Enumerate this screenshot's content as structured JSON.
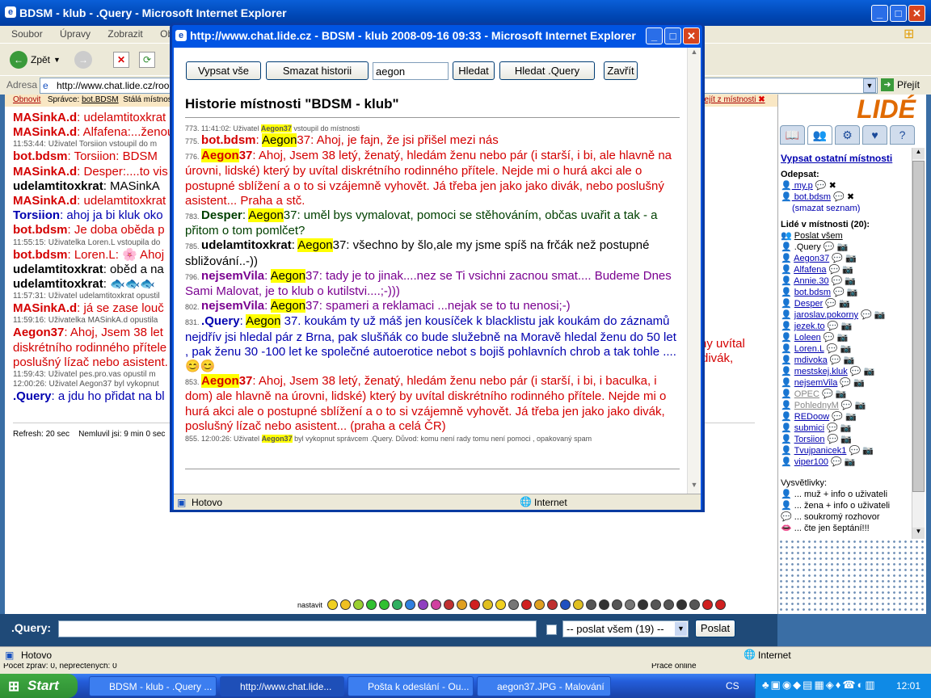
{
  "main_window": {
    "title": "BDSM - klub - .Query - Microsoft Internet Explorer",
    "menu": [
      "Soubor",
      "Úpravy",
      "Zobrazit",
      "Oblíbené"
    ],
    "toolbar": {
      "back": "Zpět"
    },
    "address_label": "Adresa",
    "address_value": "http://www.chat.lide.cz/room",
    "go_label": "Přejít"
  },
  "room_bar": {
    "refresh": "Obnovit",
    "admin_prefix": "Správce:",
    "admin": "bot.BDSM",
    "permanent": "Stálá místnost",
    "leave": "dejít z místnosti"
  },
  "chat_lines": [
    {
      "nick": "MASinkA.d",
      "text": ": udelamtitoxkrat",
      "cls": "red"
    },
    {
      "nick": "MASinkA.d",
      "text": ": Alfafena:...ženou",
      "cls": "red"
    },
    {
      "sys": "11:53:44: Uživatel Torsiion vstoupil do m"
    },
    {
      "nick": "bot.bdsm",
      "text": ": Torsiion: BDSM",
      "cls": "red"
    },
    {
      "nick": "MASinkA.d",
      "text": ": Desper:....to vis",
      "cls": "red"
    },
    {
      "nick": "udelamtitoxkrat",
      "text": ": MASinkA",
      "cls": "blk"
    },
    {
      "nick": "MASinkA.d",
      "text": ": udelamtitoxkrat",
      "cls": "red"
    },
    {
      "nick": "Torsiion",
      "text": ": ahoj ja bi kluk oko",
      "cls": "blu"
    },
    {
      "nick": "bot.bdsm",
      "text": ": Je doba oběda p",
      "cls": "red"
    },
    {
      "sys": "11:55:15: Uživatelka Loren.L vstoupila do"
    },
    {
      "nick": "bot.bdsm",
      "text": ": Loren.L: 🌸 Ahoj",
      "cls": "red"
    },
    {
      "nick": "udelamtitoxkrat",
      "text": ": oběd a na",
      "cls": "blk"
    },
    {
      "nick": "udelamtitoxkrat",
      "text": ": 🐟🐟🐟",
      "cls": "blk"
    },
    {
      "sys": "11:57:31: Uživatel udelamtitoxkrat opustil"
    },
    {
      "nick": "MASinkA.d",
      "text": ": já se zase louč",
      "cls": "red"
    },
    {
      "sys": "11:59:16: Uživatelka MASinkA.d opustila"
    },
    {
      "nick": "Aegon37",
      "text": ": Ahoj, Jsem 38 let",
      "cls": "red2"
    },
    {
      "cont": "diskrétního rodinného přítele"
    },
    {
      "cont": "poslušný lízač nebo asistent."
    },
    {
      "sys": "11:59:43: Uživatel pes.pro.vas opustil m"
    },
    {
      "sys": "12:00:26: Uživatel Aegon37 byl vykopnut"
    },
    {
      "nick": ".Query",
      "text": ": a jdu ho přidat na bl",
      "cls": "blub"
    }
  ],
  "chat_right_fragments": {
    "line1": "hy uvítal",
    "line2": "divák,"
  },
  "refresh_info": "Refresh: 20 sec    Nemluvil jsi: 9 min 0 sec",
  "popup": {
    "title": "http://www.chat.lide.cz - BDSM - klub 2008-09-16 09:33 - Microsoft Internet Explorer",
    "buttons": {
      "list_all": "Vypsat vše",
      "clear": "Smazat historii",
      "search": "Hledat",
      "search_query": "Hledat .Query",
      "close": "Zavřít"
    },
    "search_value": "aegon",
    "heading": "Historie místnosti \"BDSM - klub\"",
    "status_left": "Hotovo",
    "status_zone": "Internet"
  },
  "history": [
    {
      "n": "773. 11:41:02: Uživatel ",
      "hl": "Aegon37",
      "rest": " vstoupil do místnosti",
      "sys": true
    },
    {
      "n": "775.",
      "nick": "bot.bdsm",
      "ncls": "redb",
      "hl": "Aegon",
      "text": "37: Ahoj, je fajn, že jsi přišel mezi nás",
      "tcls": "red"
    },
    {
      "n": "776.",
      "nickhl": "Aegon",
      "nick": "37",
      "ncls": "redb",
      "text": ": Ahoj, Jsem 38 letý, ženatý, hledám ženu nebo pár (i starší, i bi, ale hlavně na úrovni, lidské) který by uvítal diskrétního rodinného přítele. Nejde mi o hurá akci ale o postupné sblížení a o to si vzájemně vyhovět. Já třeba jen jako jako divák, nebo poslušný asistent... Praha a stč.",
      "tcls": "red"
    },
    {
      "n": "783.",
      "nick": "Desper",
      "ncls": "grn",
      "hl": "Aegon",
      "text": "37: uměl bys vymalovat, pomoci se stěhováním, občas uvařit a tak - a přitom o tom pomlčet?",
      "tcls": "grn2"
    },
    {
      "n": "785.",
      "nick": "udelamtitoxkrat",
      "ncls": "blk",
      "hl": "Aegon",
      "text": "37: všechno by šlo,ale my jsme spíš na frčák než postupné sbližování..-))",
      "tcls": "dk"
    },
    {
      "n": "796.",
      "nick": "nejsemVila",
      "ncls": "purb",
      "hl": "Aegon",
      "text": "37: tady je to jinak....nez se Ti vsichni zacnou smat.... Budeme Dnes Sami Malovat, je to klub o kutilstvi....;-)))",
      "tcls": "pur"
    },
    {
      "n": "802.",
      "nick": "nejsemVila",
      "ncls": "purb",
      "hl": "Aegon",
      "text": "37: spameri a reklamaci ...nejak se to tu nenosi;-)",
      "tcls": "pur"
    },
    {
      "n": "831.",
      "nick": ".Query",
      "ncls": "blub",
      "hl": "Aegon",
      "text": " 37. koukám ty už máš jen kousíček k blacklistu jak koukám do záznamů nejdřív jsi hledal pár z Brna, pak slušňák co bude služebně na Moravě hledal ženu do 50 let , pak ženu 30 -100 let ke společné autoerotice nebot s bojiš pohlavních chrob a tak tohle ....😊😊",
      "tcls": "blu"
    },
    {
      "n": "853.",
      "nickhl": "Aegon",
      "nick": "37",
      "ncls": "redb",
      "text": ": Ahoj, Jsem 38 letý, ženatý, hledám ženu nebo pár (i starší, i bi, i baculka, i dom) ale hlavně na úrovni, lidské) který by uvítal diskrétního rodinného přítele. Nejde mi o hurá akci ale o postupné sblížení a o to si vzájemně vyhovět. Já třeba jen jako jako divák, poslušný lízač nebo asistent... (praha a celá ČR)",
      "tcls": "red"
    },
    {
      "n": "855. 12:00:26: Uživatel ",
      "hl": "Aegon37",
      "rest": " byl vykopnut správcem .Query. Důvod: komu není rady tomu není pomoci , opakovaný spam",
      "sys": true
    }
  ],
  "sidebar": {
    "logo": "LIDÉ",
    "list_other": "Vypsat ostatní místnosti",
    "odepsat": "Odepsat:",
    "odepsat_users": [
      "my.p",
      "bot.bdsm"
    ],
    "clear_list": "(smazat seznam)",
    "people_header": "Lidé v místnosti (20):",
    "post_all": "Poslat všem",
    "users": [
      ".Query",
      "Aegon37",
      "Alfafena",
      "Annie.30",
      "bot.bdsm",
      "Desper",
      "jaroslav.pokorny",
      "jezek.to",
      "Loleen",
      "Loren.L",
      "mdivoka",
      "mestskej.kluk",
      "nejsemVila",
      "OPEC",
      "PohlednyM",
      "REDoow",
      "submici",
      "Torsiion",
      "Tvujpanicek1",
      "viper100"
    ],
    "legend_header": "Vysvětlivky:",
    "legend": [
      "... muž + info o uživateli",
      "... žena + info o uživateli",
      "... soukromý rozhovor",
      "... čte jen šeptání!!!"
    ]
  },
  "bottom": {
    "emoji_label": "nastavit",
    "nick": ".Query:",
    "send_select": "-- poslat všem (19) --",
    "send_button": "Poslat"
  },
  "statusbar": {
    "left": "Hotovo",
    "zone": "Internet",
    "under_left": "Počet zpráv: 0, nepřečtených: 0",
    "under_right": "Práce online"
  },
  "taskbar": {
    "start": "Start",
    "items": [
      "BDSM - klub - .Query ...",
      "http://www.chat.lide...",
      "Pošta k odeslání - Ou...",
      "aegon37.JPG - Malování"
    ],
    "lang": "CS",
    "clock": "12:01"
  },
  "colors": {
    "ie_blue": "#0054e3",
    "red": "#d40000",
    "highlight": "#ffff00",
    "taskbar": "#245edb"
  }
}
